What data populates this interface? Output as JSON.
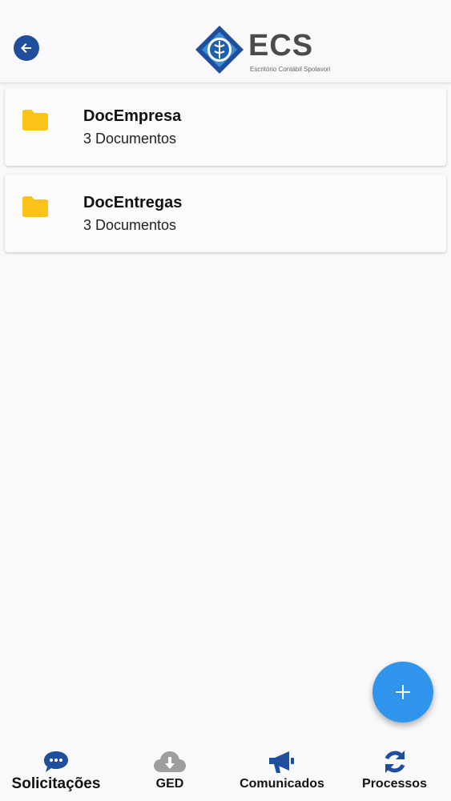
{
  "header": {
    "back_icon": "arrow-left-circle-icon",
    "logo": {
      "brand": "ECS",
      "subtitle": "Escritório Contábil Spolavori"
    }
  },
  "folders": [
    {
      "name": "DocEmpresa",
      "count_label": "3 Documentos",
      "icon": "folder-icon"
    },
    {
      "name": "DocEntregas",
      "count_label": "3 Documentos",
      "icon": "folder-icon"
    }
  ],
  "fab": {
    "icon": "plus-icon"
  },
  "bottom_nav": {
    "items": [
      {
        "label": "Solicitações",
        "icon": "chat-bubble-icon",
        "active": true
      },
      {
        "label": "GED",
        "icon": "cloud-download-icon",
        "active": false
      },
      {
        "label": "Comunicados",
        "icon": "megaphone-icon",
        "active": false
      },
      {
        "label": "Processos",
        "icon": "sync-icon",
        "active": false
      }
    ]
  },
  "colors": {
    "primary": "#1f4e9c",
    "fab": "#2f95ec",
    "folder": "#fcc419",
    "background": "#f9f9fb",
    "inactive_icon": "#9e9e9e"
  }
}
